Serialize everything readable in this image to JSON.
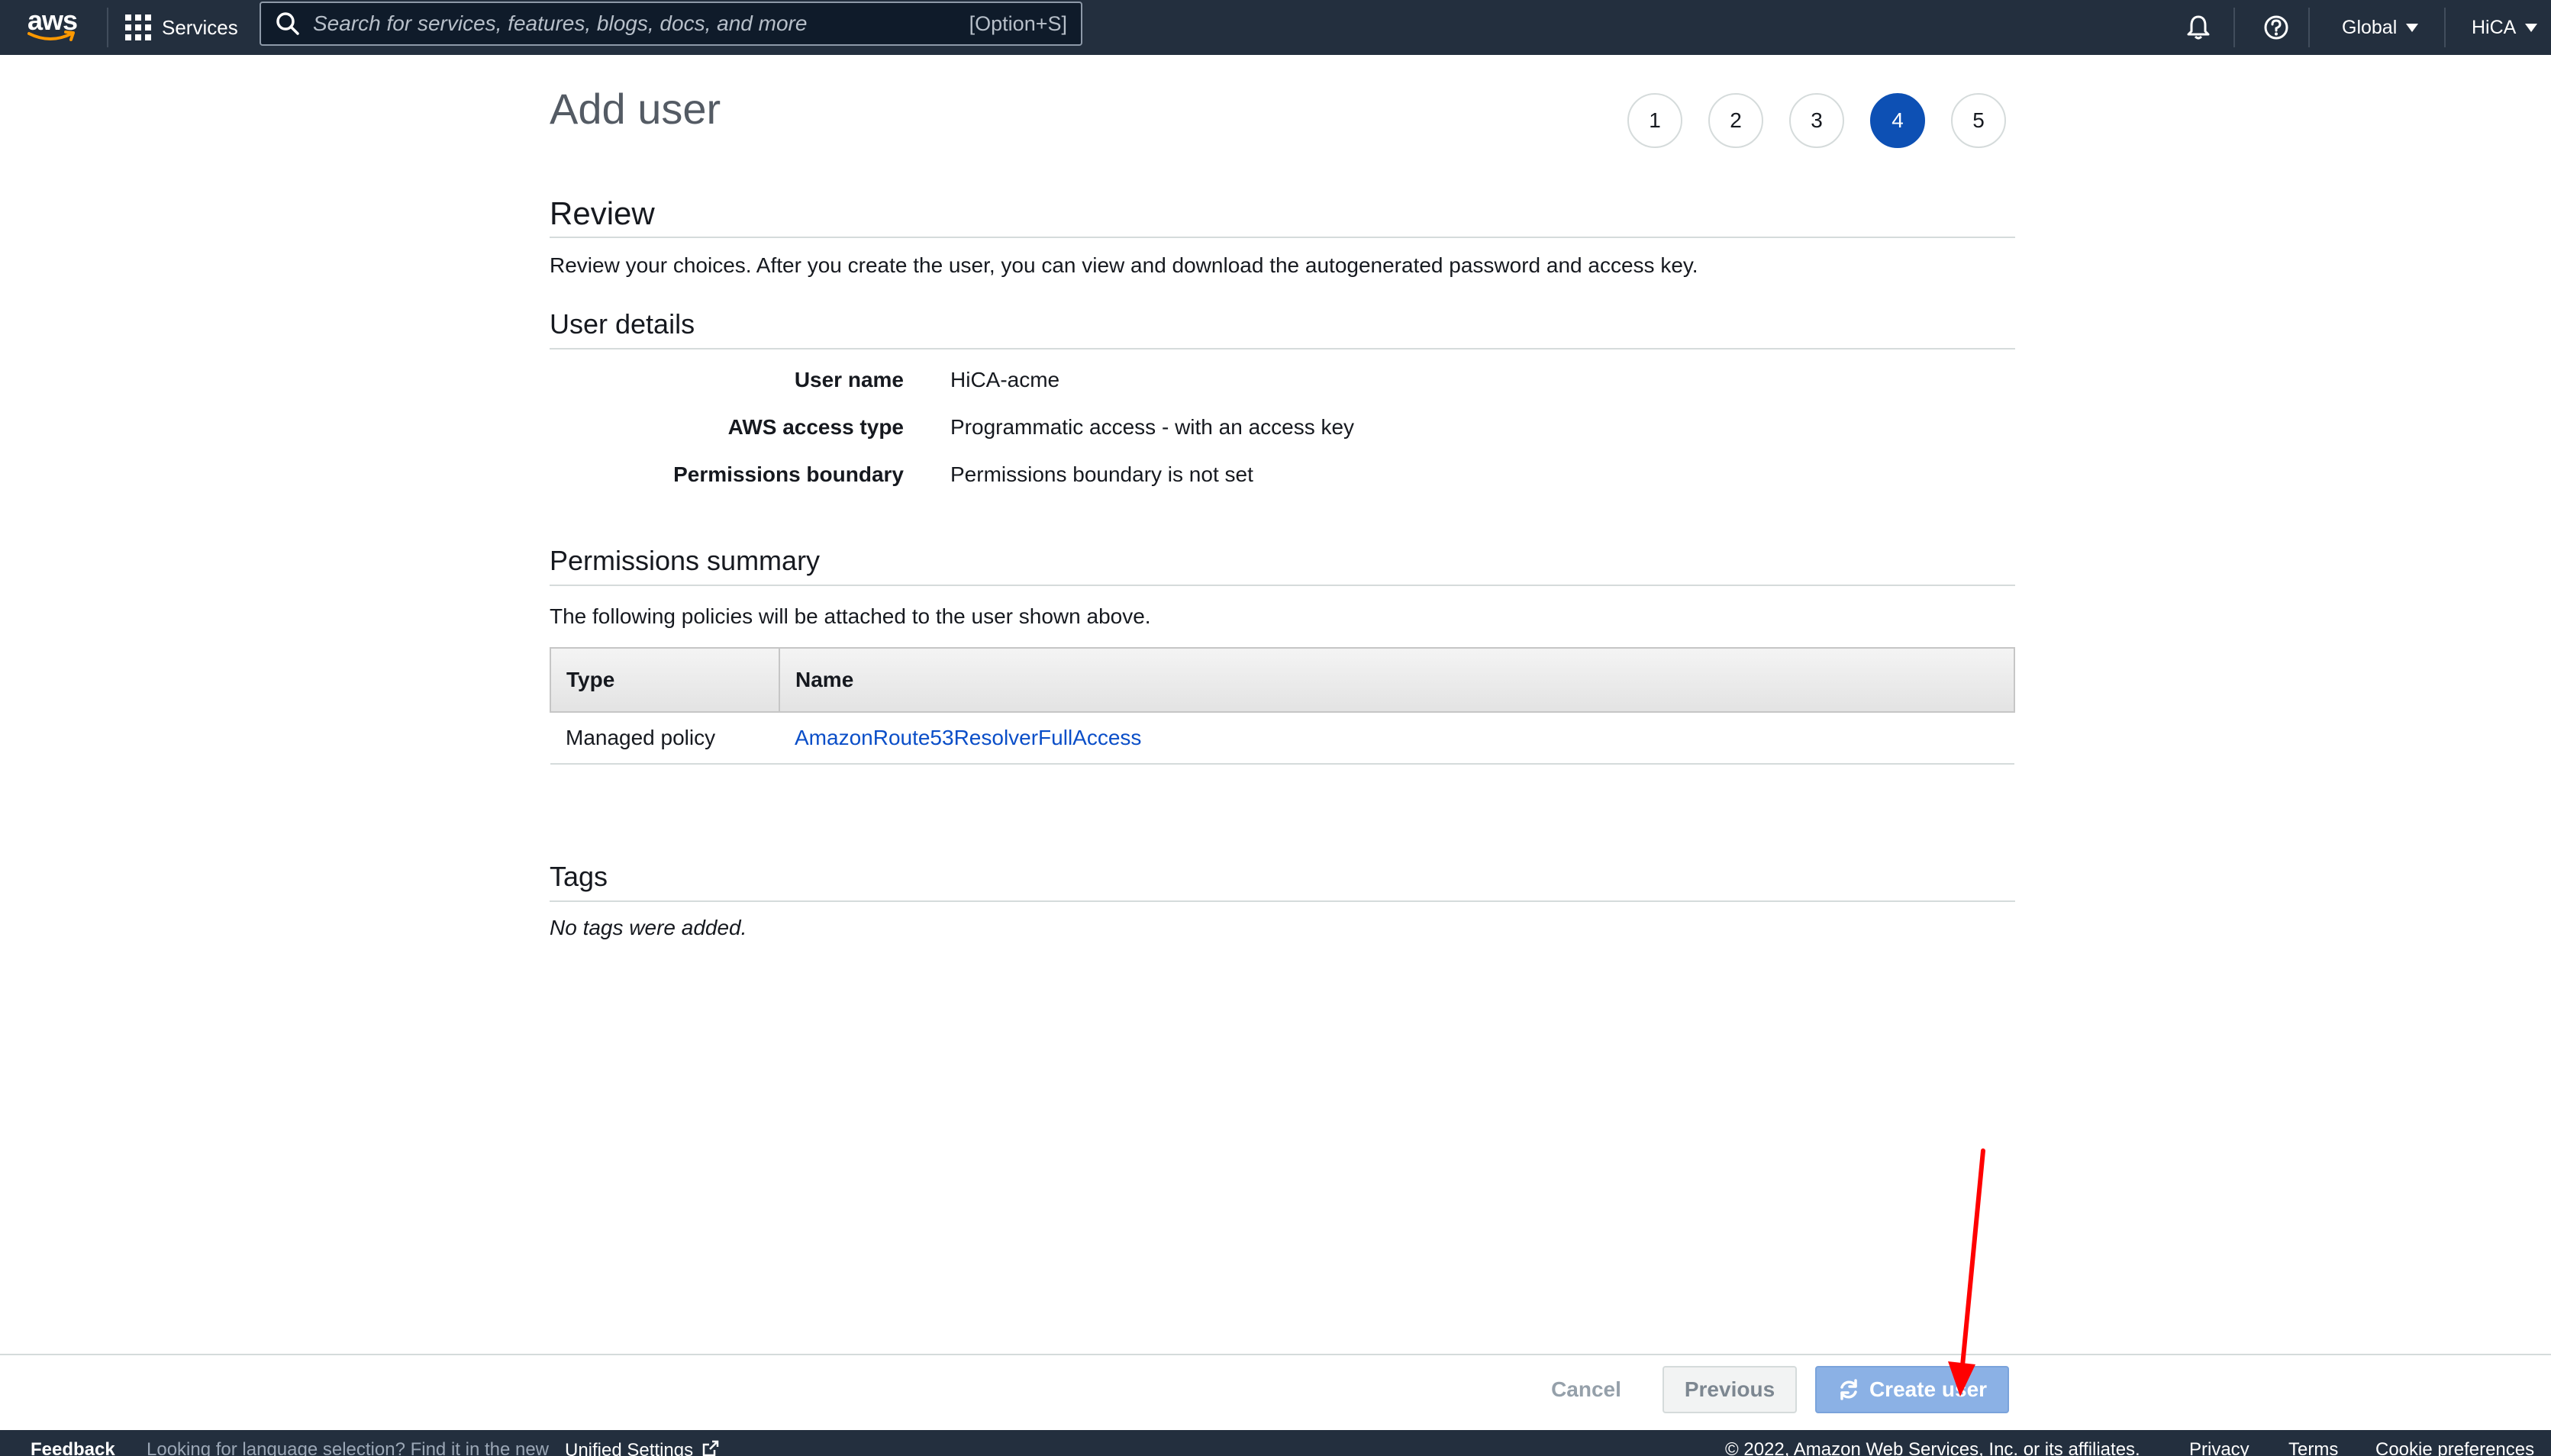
{
  "topnav": {
    "logo_text": "aws",
    "services_label": "Services",
    "search_placeholder": "Search for services, features, blogs, docs, and more",
    "search_shortcut": "[Option+S]",
    "region_label": "Global",
    "account_label": "HiCA"
  },
  "page": {
    "title": "Add user",
    "steps": [
      "1",
      "2",
      "3",
      "4",
      "5"
    ],
    "active_step": "4"
  },
  "review": {
    "heading": "Review",
    "description": "Review your choices. After you create the user, you can view and download the autogenerated password and access key."
  },
  "user_details": {
    "heading": "User details",
    "rows": [
      {
        "key": "User name",
        "value": "HiCA-acme"
      },
      {
        "key": "AWS access type",
        "value": "Programmatic access - with an access key"
      },
      {
        "key": "Permissions boundary",
        "value": "Permissions boundary is not set"
      }
    ]
  },
  "permissions": {
    "heading": "Permissions summary",
    "description": "The following policies will be attached to the user shown above.",
    "columns": [
      "Type",
      "Name"
    ],
    "rows": [
      {
        "type": "Managed policy",
        "name": "AmazonRoute53ResolverFullAccess"
      }
    ]
  },
  "tags": {
    "heading": "Tags",
    "empty_text": "No tags were added."
  },
  "actions": {
    "cancel": "Cancel",
    "previous": "Previous",
    "create": "Create user"
  },
  "footer": {
    "feedback": "Feedback",
    "language_text": "Looking for language selection? Find it in the new",
    "unified_settings": "Unified Settings",
    "copyright": "© 2022, Amazon Web Services, Inc. or its affiliates.",
    "privacy": "Privacy",
    "terms": "Terms",
    "cookie": "Cookie preferences"
  },
  "colors": {
    "nav_bg": "#232f3e",
    "active_step": "#0d50b4",
    "link": "#0a4ec8",
    "create_button": "#8bb1e5",
    "annotation_arrow": "#ff0000"
  },
  "icons": [
    "aws-logo",
    "grid-icon",
    "search-icon",
    "bell-icon",
    "help-icon",
    "refresh-icon",
    "external-link-icon"
  ]
}
